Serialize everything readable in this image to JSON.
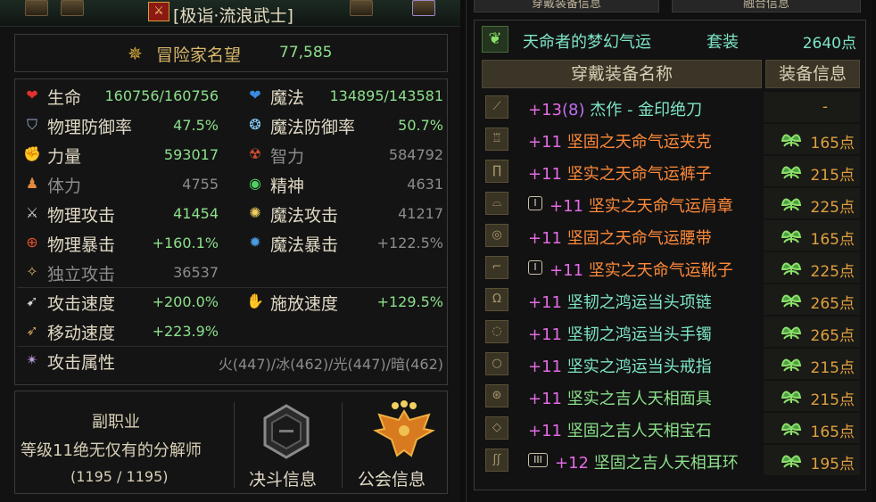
{
  "title": "[极诣·流浪武士]",
  "fame": {
    "label": "冒险家名望",
    "value": "77,585"
  },
  "stats": [
    {
      "icon": "heart-icon",
      "label": "生命",
      "value": "160756/160756",
      "label2": "魔法",
      "icon2": "mana-heart-icon",
      "value2": "134895/143581"
    },
    {
      "icon": "shield-icon",
      "label": "物理防御率",
      "value": "47.5%",
      "label2": "魔法防御率",
      "icon2": "magic-shield-icon",
      "value2": "50.7%"
    },
    {
      "icon": "strength-icon",
      "label": "力量",
      "value": "593017",
      "label2": "智力",
      "icon2": "intelligence-icon",
      "value2": "584792"
    },
    {
      "icon": "stamina-icon",
      "label": "体力",
      "value": "4755",
      "label2": "精神",
      "icon2": "spirit-icon",
      "value2": "4631"
    },
    {
      "icon": "sword-icon",
      "label": "物理攻击",
      "value": "41454",
      "label2": "魔法攻击",
      "icon2": "magic-attack-icon",
      "value2": "41217"
    },
    {
      "icon": "crosshair-icon",
      "label": "物理暴击",
      "value": "+160.1%",
      "label2": "魔法暴击",
      "icon2": "magic-crit-icon",
      "value2": "+122.5%"
    },
    {
      "icon": "independent-attack-icon",
      "label": "独立攻击",
      "value": "36537",
      "label2": "",
      "icon2": "",
      "value2": ""
    },
    {
      "icon": "attack-speed-icon",
      "label": "攻击速度",
      "value": "+200.0%",
      "label2": "施放速度",
      "icon2": "cast-speed-icon",
      "value2": "+129.5%"
    },
    {
      "icon": "move-speed-icon",
      "label": "移动速度",
      "value": "+223.9%",
      "label2": "",
      "icon2": "",
      "value2": ""
    },
    {
      "icon": "element-icon",
      "label": "攻击属性",
      "value": "火(447)/冰(462)/光(447)/暗(462)",
      "label2": "",
      "icon2": "",
      "value2": ""
    }
  ],
  "subjob": {
    "title": "副职业",
    "desc": "等级11绝无仅有的分解师",
    "progress": "(1195 / 1195)"
  },
  "duel": {
    "label": "决斗信息"
  },
  "guild": {
    "label": "公会信息"
  },
  "tabs": [
    "穿戴装备信息",
    "融合信息"
  ],
  "set": {
    "name": "天命者的梦幻气运",
    "kind": "套装",
    "points": "2640点"
  },
  "headers": {
    "name": "穿戴装备名称",
    "info": "装备信息"
  },
  "equipment": [
    {
      "icon": "weapon-icon",
      "prefix": "",
      "plus": "+13",
      "amp": "(8)",
      "name": "杰作 - 金印绝刀",
      "color": "cyan",
      "points": "-",
      "leaf": false
    },
    {
      "icon": "top-armor-icon",
      "prefix": "",
      "plus": "+11",
      "amp": "",
      "name": "坚固之天命气运夹克",
      "color": "orange",
      "points": "165点",
      "leaf": true
    },
    {
      "icon": "pants-icon",
      "prefix": "",
      "plus": "+11",
      "amp": "",
      "name": "坚实之天命气运裤子",
      "color": "orange",
      "points": "215点",
      "leaf": true
    },
    {
      "icon": "shoulder-icon",
      "prefix": "I",
      "plus": "+11",
      "amp": "",
      "name": "坚实之天命气运肩章",
      "color": "orange",
      "points": "225点",
      "leaf": true
    },
    {
      "icon": "belt-icon",
      "prefix": "",
      "plus": "+11",
      "amp": "",
      "name": "坚固之天命气运腰带",
      "color": "orange",
      "points": "165点",
      "leaf": true
    },
    {
      "icon": "boots-icon",
      "prefix": "I",
      "plus": "+11",
      "amp": "",
      "name": "坚实之天命气运靴子",
      "color": "orange",
      "points": "225点",
      "leaf": true
    },
    {
      "icon": "necklace-icon",
      "prefix": "",
      "plus": "+11",
      "amp": "",
      "name": "坚韧之鸿运当头项链",
      "color": "cyan",
      "points": "265点",
      "leaf": true
    },
    {
      "icon": "bracelet-icon",
      "prefix": "",
      "plus": "+11",
      "amp": "",
      "name": "坚韧之鸿运当头手镯",
      "color": "cyan",
      "points": "265点",
      "leaf": true
    },
    {
      "icon": "ring-icon",
      "prefix": "",
      "plus": "+11",
      "amp": "",
      "name": "坚实之鸿运当头戒指",
      "color": "cyan",
      "points": "215点",
      "leaf": true
    },
    {
      "icon": "support-icon",
      "prefix": "",
      "plus": "+11",
      "amp": "",
      "name": "坚实之吉人天相面具",
      "color": "green",
      "points": "215点",
      "leaf": true
    },
    {
      "icon": "magic-stone-icon",
      "prefix": "",
      "plus": "+11",
      "amp": "",
      "name": "坚固之吉人天相宝石",
      "color": "green",
      "points": "165点",
      "leaf": true
    },
    {
      "icon": "earring-icon",
      "prefix": "III",
      "plus": "+12",
      "amp": "",
      "name": "坚固之吉人天相耳环",
      "color": "green",
      "points": "195点",
      "leaf": true
    }
  ]
}
